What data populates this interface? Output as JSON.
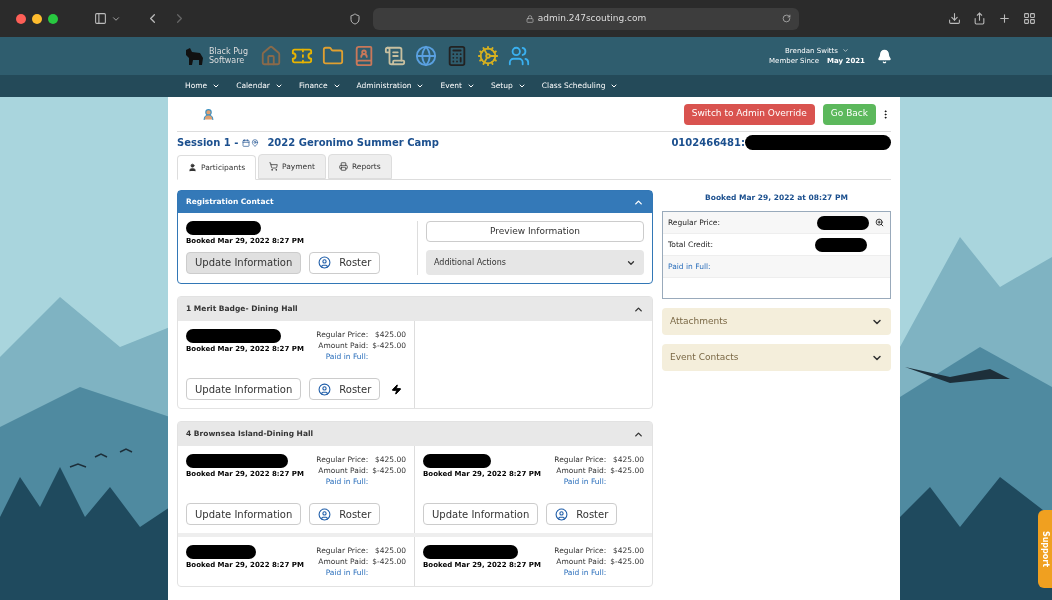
{
  "browser": {
    "url": "admin.247scouting.com"
  },
  "header": {
    "brand": "Black Pug",
    "brand_sub": "Software",
    "user_name": "Brendan Switts",
    "member_since_label": "Member Since",
    "member_since": "May 2021"
  },
  "nav": [
    {
      "label": "Home"
    },
    {
      "label": "Calendar"
    },
    {
      "label": "Finance"
    },
    {
      "label": "Administration"
    },
    {
      "label": "Event"
    },
    {
      "label": "Setup"
    },
    {
      "label": "Class Scheduling"
    }
  ],
  "actions": {
    "override": "Switch to Admin Override",
    "back": "Go Back"
  },
  "session": {
    "title": "Session 1 -",
    "event": "2022 Geronimo Summer Camp",
    "account": "0102466481:"
  },
  "tabs": [
    {
      "label": "Participants",
      "selected": true
    },
    {
      "label": "Payment",
      "selected": false
    },
    {
      "label": "Reports",
      "selected": false
    }
  ],
  "registration_contact": {
    "title": "Registration Contact",
    "expanded": true,
    "booked": "Booked Mar 29, 2022 8:27 PM",
    "update": "Update Information",
    "roster": "Roster",
    "preview": "Preview Information",
    "additional": "Additional Actions"
  },
  "groups": [
    {
      "title": "1 Merit Badge- Dining Hall",
      "expanded": true,
      "cards": [
        {
          "booked": "Booked Mar 29, 2022 8:27 PM",
          "price_label": "Regular Price:",
          "price": "$425.00",
          "paid_label": "Amount Paid:",
          "paid": "$-425.00",
          "status": "Paid in Full:",
          "update": "Update Information",
          "roster": "Roster",
          "flash": true
        }
      ]
    },
    {
      "title": "4 Brownsea Island-Dining Hall",
      "expanded": true,
      "cards": [
        {
          "booked": "Booked Mar 29, 2022 8:27 PM",
          "price_label": "Regular Price:",
          "price": "$425.00",
          "paid_label": "Amount Paid:",
          "paid": "$-425.00",
          "status": "Paid in Full:",
          "update": "Update Information",
          "roster": "Roster",
          "flash": false
        },
        {
          "booked": "Booked Mar 29, 2022 8:27 PM",
          "price_label": "Regular Price:",
          "price": "$425.00",
          "paid_label": "Amount Paid:",
          "paid": "$-425.00",
          "status": "Paid in Full:",
          "update": "Update Information",
          "roster": "Roster",
          "flash": false
        },
        {
          "booked": "Booked Mar 29, 2022 8:27 PM",
          "price_label": "Regular Price:",
          "price": "$425.00",
          "paid_label": "Amount Paid:",
          "paid": "$-425.00",
          "status": "Paid in Full:",
          "flash": false
        },
        {
          "booked": "Booked Mar 29, 2022 8:27 PM",
          "price_label": "Regular Price:",
          "price": "$425.00",
          "paid_label": "Amount Paid:",
          "paid": "$-425.00",
          "status": "Paid in Full:",
          "flash": false
        }
      ]
    }
  ],
  "summary": {
    "booked": "Booked Mar 29, 2022 at 08:27 PM",
    "rows": [
      {
        "label": "Regular Price:",
        "kind": "redacted",
        "zoom": true
      },
      {
        "label": "Total Credit:",
        "kind": "redacted",
        "zoom": false
      },
      {
        "label": "Paid in Full:",
        "kind": "status",
        "zoom": false
      }
    ]
  },
  "accordions": [
    {
      "title": "Attachments",
      "expanded": false
    },
    {
      "title": "Event Contacts",
      "expanded": false
    }
  ],
  "support": "Support"
}
